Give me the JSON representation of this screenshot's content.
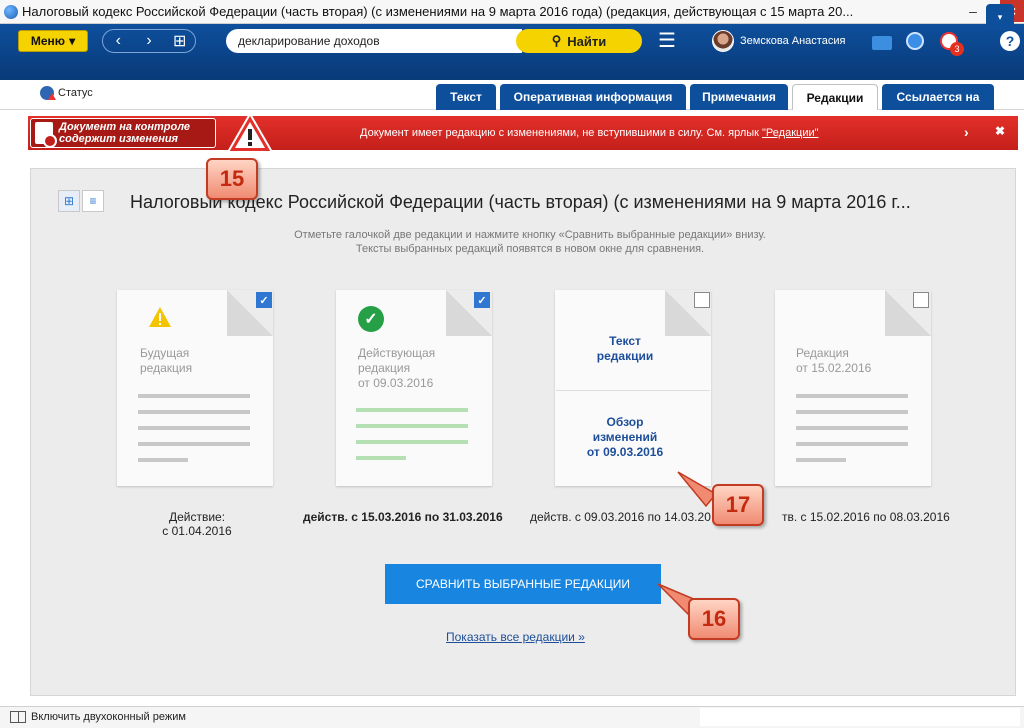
{
  "window": {
    "title": "Налоговый кодекс Российской Федерации (часть вторая) (с изменениями на 9 марта 2016 года) (редакция, действующая с 15 марта 20...",
    "min_label": "–",
    "max_label": "□",
    "close_label": "×"
  },
  "toolbar": {
    "menu_label": "Меню",
    "menu_caret": "▾",
    "back_icon": "‹",
    "forward_icon": "›",
    "grid_icon": "⊞",
    "search_value": "декларирование доходов",
    "find_icon": "⚲",
    "find_label": "Найти",
    "hamburger": "☰",
    "user_name": "Земскова Анастасия",
    "timer_badge": "3",
    "help_label": "?"
  },
  "status": {
    "label": "Статус"
  },
  "tabs": [
    {
      "label": "Текст",
      "active": false
    },
    {
      "label": "Оперативная информация",
      "active": false
    },
    {
      "label": "Примечания",
      "active": false
    },
    {
      "label": "Редакции",
      "active": true
    },
    {
      "label": "Ссылается на",
      "active": false
    }
  ],
  "tab_more": "▾",
  "banner": {
    "control_line1": "Документ на контроле",
    "control_line2": "содержит изменения",
    "message": "Документ имеет редакцию с изменениями, не вступившими в силу. См. ярлык ",
    "message_link": "\"Редакции\"",
    "arrow": "›",
    "close": "✖"
  },
  "callouts": {
    "c15": "15",
    "c16": "16",
    "c17": "17"
  },
  "main": {
    "view_grid_icon": "⊞",
    "view_list_icon": "≡",
    "title": "Налоговый кодекс Российской Федерации (часть вторая) (с изменениями на 9 марта 2016 г...",
    "instructions_line1": "Отметьте галочкой две редакции и нажмите кнопку «Сравнить выбранные редакции» внизу.",
    "instructions_line2": "Тексты выбранных редакций появятся в новом окне для сравнения.",
    "compare_label": "СРАВНИТЬ ВЫБРАННЫЕ РЕДАКЦИИ",
    "show_all_label": "Показать все редакции »"
  },
  "editions": [
    {
      "label_line1": "Будущая",
      "label_line2": "редакция",
      "label_line3": "",
      "checked": true,
      "period_line1": "Действие:",
      "period_line2": "с 01.04.2016",
      "period_bold": false
    },
    {
      "label_line1": "Действующая",
      "label_line2": "редакция",
      "label_line3": "от 09.03.2016",
      "checked": true,
      "period_line1": "действ. с 15.03.2016 по 31.03.2016",
      "period_bold": true
    },
    {
      "link_text_line1": "Текст",
      "link_text_line2": "редакции",
      "link_review_line1": "Обзор",
      "link_review_line2": "изменений",
      "link_review_line3": "от 09.03.2016",
      "checked": false,
      "period_line1": "действ. с 09.03.2016 по 14.03.20",
      "period_bold": false
    },
    {
      "label_line1": "Редакция",
      "label_line2": "от 15.02.2016",
      "label_line3": "",
      "checked": false,
      "period_line1": "тв. с 15.02.2016 по 08.03.2016",
      "period_bold": false
    }
  ],
  "bottom": {
    "dual_mode_label": "Включить двухоконный режим"
  },
  "colors": {
    "toolbar_blue": "#0e4f9c",
    "accent_yellow": "#f5d300",
    "banner_red": "#d42a24",
    "button_blue": "#1886e0",
    "success_green": "#25a046"
  }
}
